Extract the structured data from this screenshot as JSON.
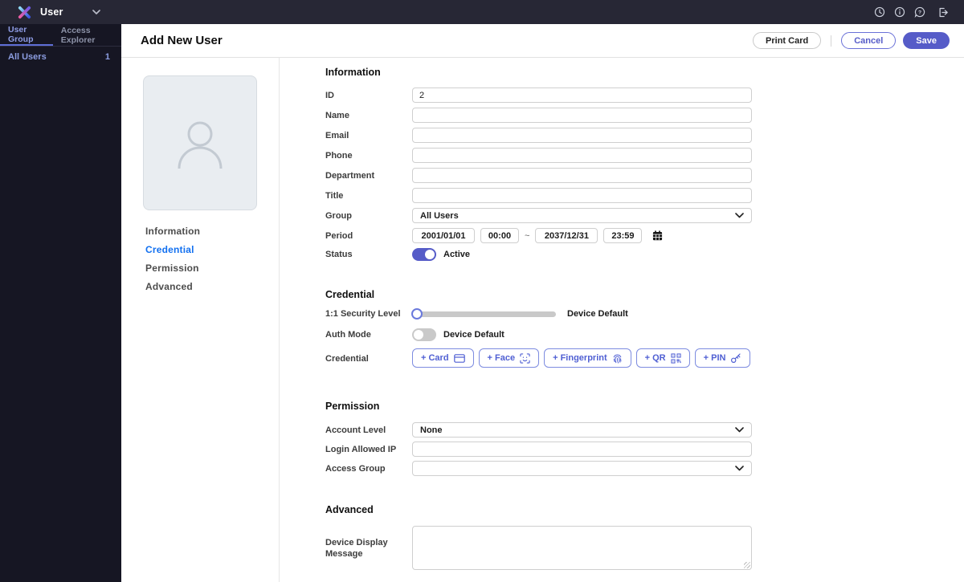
{
  "topbar": {
    "app_title": "User",
    "icons": {
      "logo": "biostar-x-logo",
      "history": "clock-icon",
      "info": "info-circle-icon",
      "help": "help-circle-icon",
      "logout": "logout-icon"
    }
  },
  "sidebar": {
    "tabs": [
      {
        "label": "User Group"
      },
      {
        "label": "Access Explorer"
      }
    ],
    "items": [
      {
        "label": "All Users",
        "count": "1"
      }
    ]
  },
  "header": {
    "title": "Add New User",
    "print_card_label": "Print Card",
    "cancel_label": "Cancel",
    "save_label": "Save"
  },
  "nav": {
    "items": [
      {
        "label": "Information"
      },
      {
        "label": "Credential"
      },
      {
        "label": "Permission"
      },
      {
        "label": "Advanced"
      }
    ],
    "active": "Credential"
  },
  "information": {
    "heading": "Information",
    "id_label": "ID",
    "id_value": "2",
    "name_label": "Name",
    "name_value": "",
    "email_label": "Email",
    "email_value": "",
    "phone_label": "Phone",
    "phone_value": "",
    "department_label": "Department",
    "department_value": "",
    "title_label": "Title",
    "title_value": "",
    "group_label": "Group",
    "group_value": "All Users",
    "period_label": "Period",
    "period_start_date": "2001/01/01",
    "period_start_time": "00:00",
    "period_separator": "~",
    "period_end_date": "2037/12/31",
    "period_end_time": "23:59",
    "status_label": "Status",
    "status_value": "Active",
    "status_on": true
  },
  "credential": {
    "heading": "Credential",
    "security_level_label": "1:1 Security Level",
    "security_level_value": "Device Default",
    "auth_mode_label": "Auth Mode",
    "auth_mode_value": "Device Default",
    "auth_mode_on": false,
    "credential_label": "Credential",
    "buttons": [
      {
        "label": "+ Card",
        "icon": "card-icon"
      },
      {
        "label": "+ Face",
        "icon": "face-scan-icon"
      },
      {
        "label": "+ Fingerprint",
        "icon": "fingerprint-icon"
      },
      {
        "label": "+ QR",
        "icon": "qr-code-icon"
      },
      {
        "label": "+ PIN",
        "icon": "key-icon"
      }
    ]
  },
  "permission": {
    "heading": "Permission",
    "account_level_label": "Account Level",
    "account_level_value": "None",
    "login_ip_label": "Login Allowed IP",
    "login_ip_value": "",
    "access_group_label": "Access Group",
    "access_group_value": ""
  },
  "advanced": {
    "heading": "Advanced",
    "device_message_label": "Device Display Message",
    "device_message_value": ""
  },
  "colors": {
    "accent": "#565cc8",
    "nav_active": "#1270f0",
    "topbar_bg": "#272735",
    "sidebar_bg": "#161623",
    "credential_button": "#5b6bd5"
  }
}
